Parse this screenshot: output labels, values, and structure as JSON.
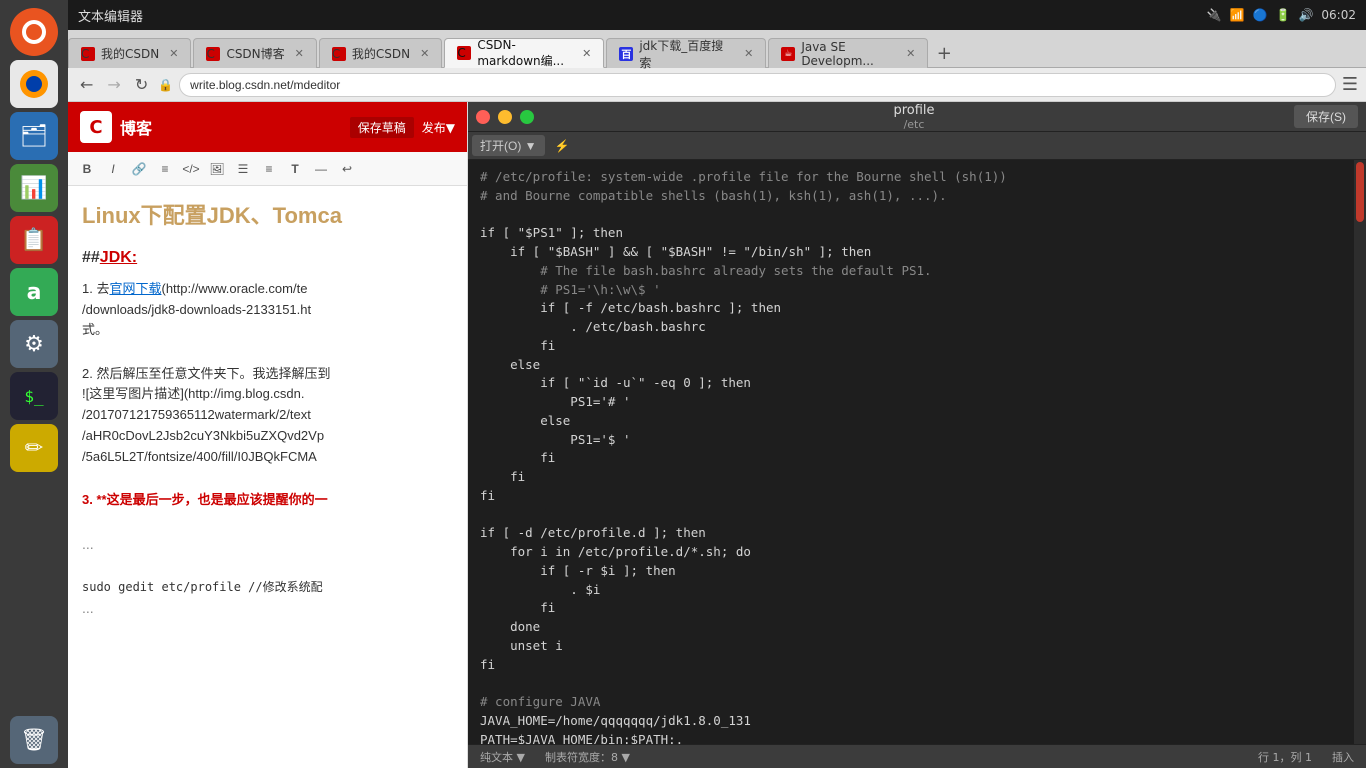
{
  "topbar": {
    "title": "文本编辑器",
    "time": "06:02",
    "icons": [
      "network-wifi",
      "bluetooth",
      "battery",
      "volume",
      "clock"
    ]
  },
  "tabs": [
    {
      "id": 1,
      "label": "我的CSDN",
      "icon_type": "csdn",
      "active": false
    },
    {
      "id": 2,
      "label": "CSDN博客",
      "icon_type": "csdn",
      "active": false
    },
    {
      "id": 3,
      "label": "我的CSDN",
      "icon_type": "csdn",
      "active": false
    },
    {
      "id": 4,
      "label": "CSDN-markdown编...",
      "icon_type": "csdn",
      "active": true
    },
    {
      "id": 5,
      "label": "jdk下载_百度搜索",
      "icon_type": "baidu",
      "active": false
    },
    {
      "id": 6,
      "label": "Java SE Developm...",
      "icon_type": "oracle",
      "active": false
    }
  ],
  "addressbar": {
    "url": "write.blog.csdn.net/mdeditor"
  },
  "blog": {
    "header_title": "博客",
    "title": "Linux下配置JDK、Tomca",
    "h2": "JDK:",
    "items": [
      {
        "num": "1.",
        "text_before": "去",
        "link_text": "官网下载",
        "link_url": "(http://www.oracle.com/te",
        "text_after": "/downloads/jdk8-downloads-2133151.ht",
        "suffix": "式。"
      },
      {
        "num": "2.",
        "text_before": "然后解压至任意文件夹下。我选择解压到",
        "image_text": "![这里写图片描述]",
        "image_url": "(http://img.blog.csdn.",
        "url_cont": "/201707121759365112watermark/2/text/aHR0cDovL2Jsb2cuY3Nkbi5uZXQvd2Vp/5a6L5L2T/fontsize/400/fill/I0JBQkFCMA"
      },
      {
        "num": "3.",
        "text_bold": "**这是最后一步，也是最应该提醒你的一**"
      }
    ],
    "code_line": "...",
    "sudo_line": "sudo gedit etc/profile //修改系统配",
    "dots2": "..."
  },
  "gedit": {
    "title": "profile",
    "subtitle": "/etc",
    "save_label": "保存(S)",
    "open_label": "打开(O)",
    "menu_items": [
      "打开(O)",
      "▼"
    ],
    "statusbar": {
      "encoding": "纯文本 ▼",
      "tab": "制表符宽度：8 ▼",
      "position": "行 1，列 1",
      "mode": "插入"
    },
    "code": "# /etc/profile: system-wide .profile file for the Bourne shell (sh(1))\n# and Bourne compatible shells (bash(1), ksh(1), ash(1), ...).\n\nif [ \"$PS1\" ]; then\n    if [ \"$BASH\" ] && [ \"$BASH\" != \"/bin/sh\" ]; then\n        # The file bash.bashrc already sets the default PS1.\n        # PS1='\\h:\\w\\$ '\n        if [ -f /etc/bash.bashrc ]; then\n            . /etc/bash.bashrc\n        fi\n    else\n        if [ \"`id -u`\" -eq 0 ]; then\n            PS1='# '\n        else\n            PS1='$ '\n        fi\n    fi\nfi\n\nif [ -d /etc/profile.d ]; then\n    for i in /etc/profile.d/*.sh; do\n        if [ -r $i ]; then\n            . $i\n        fi\n    done\n    unset i\nfi\n\n# configure JAVA\nJAVA_HOME=/home/qqqqqqq/jdk1.8.0_131\nPATH=$JAVA_HOME/bin:$PATH:.\nCLASSPATH=$JAVA_HOME/lib/dt.jar:$JAVA_HOME/lib/tools.jar:\nexport JAVA_HOME\nexport PATH\nexport CLASSPATH"
  },
  "taskbar": {
    "icons": [
      {
        "name": "ubuntu-icon",
        "label": "Ubuntu",
        "color": "#e95420"
      },
      {
        "name": "firefox-icon",
        "label": "Firefox",
        "color": "#ff6611"
      },
      {
        "name": "files-icon",
        "label": "Files",
        "color": "#2a6eb3"
      },
      {
        "name": "spreadsheet-icon",
        "label": "Spreadsheet",
        "color": "#4a8a3a"
      },
      {
        "name": "presentation-icon",
        "label": "Presentation",
        "color": "#cc2222"
      },
      {
        "name": "amazon-icon",
        "label": "Amazon",
        "color": "#33aa55"
      },
      {
        "name": "settings-icon",
        "label": "Settings",
        "color": "#556677"
      },
      {
        "name": "terminal-icon",
        "label": "Terminal",
        "color": "#222233"
      },
      {
        "name": "editor-icon",
        "label": "Editor",
        "color": "#ccaa00"
      },
      {
        "name": "trash-icon",
        "label": "Trash",
        "color": "#556677"
      }
    ]
  }
}
